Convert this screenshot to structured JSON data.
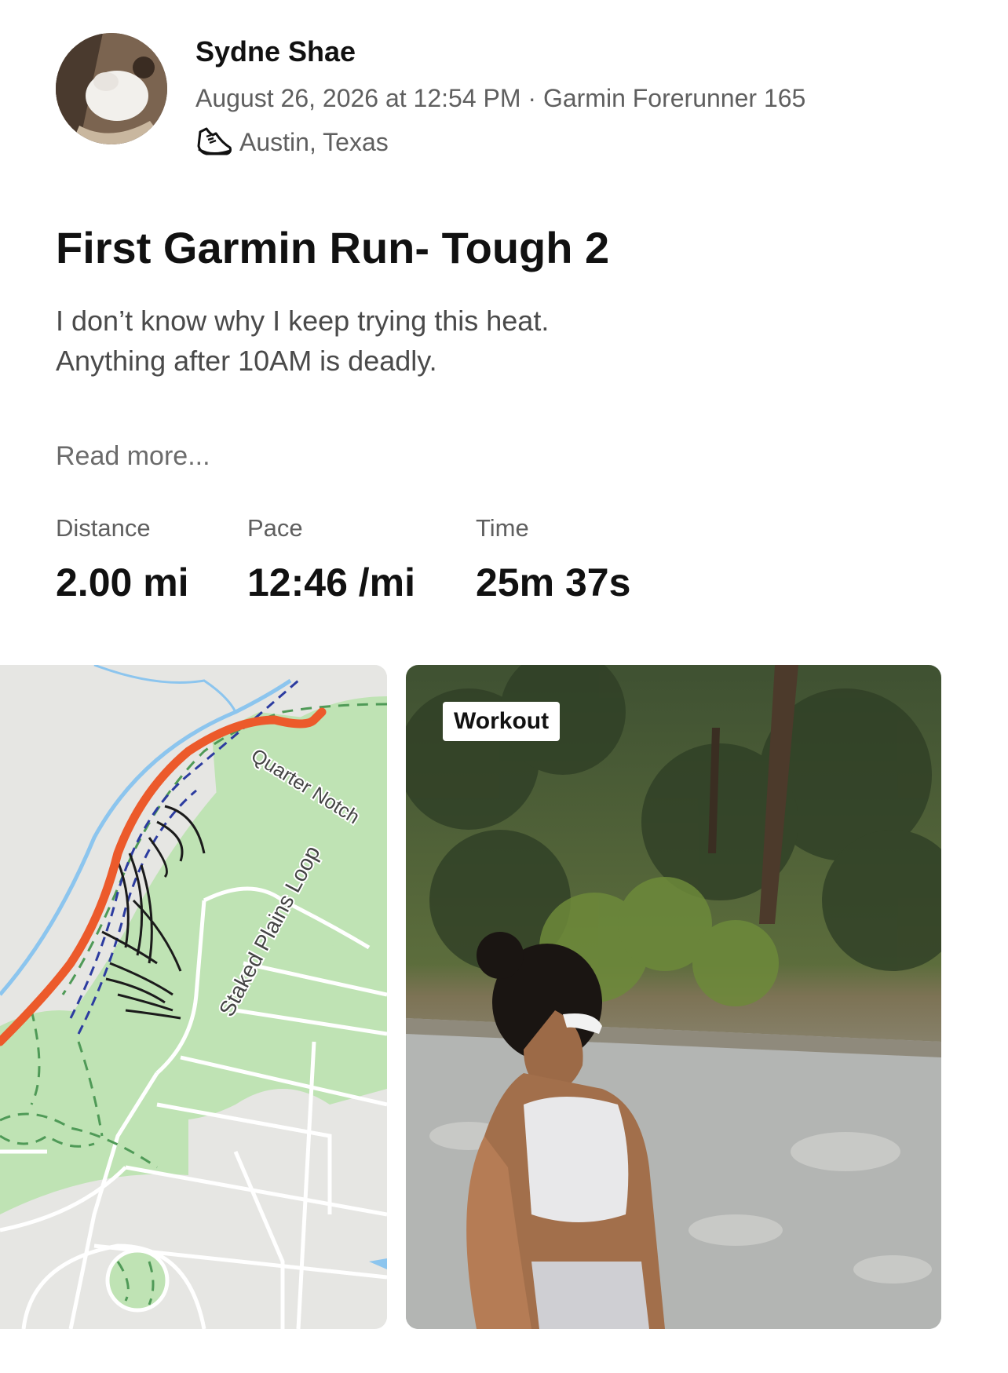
{
  "athlete": {
    "name": "Sydne Shae",
    "meta": "August 26, 2026 at 12:54 PM · Garmin Forerunner 165",
    "location": "Austin, Texas",
    "activity_icon": "running-shoe-icon"
  },
  "activity": {
    "title": "First Garmin Run- Tough 2",
    "description_line1": "I don’t know why I keep trying this heat.",
    "description_line2": "Anything after 10AM is deadly.",
    "read_more": "Read more..."
  },
  "stats": [
    {
      "label": "Distance",
      "value": "2.00 mi"
    },
    {
      "label": "Pace",
      "value": "12:46 /mi"
    },
    {
      "label": "Time",
      "value": "25m 37s"
    }
  ],
  "map": {
    "street_labels": [
      "Quarter Notch",
      "Staked Plains Loop"
    ],
    "route_color": "#ec5a2b",
    "park_color": "#bfe3b4",
    "water_color": "#8cc5ee"
  },
  "photo": {
    "badge": "Workout"
  }
}
